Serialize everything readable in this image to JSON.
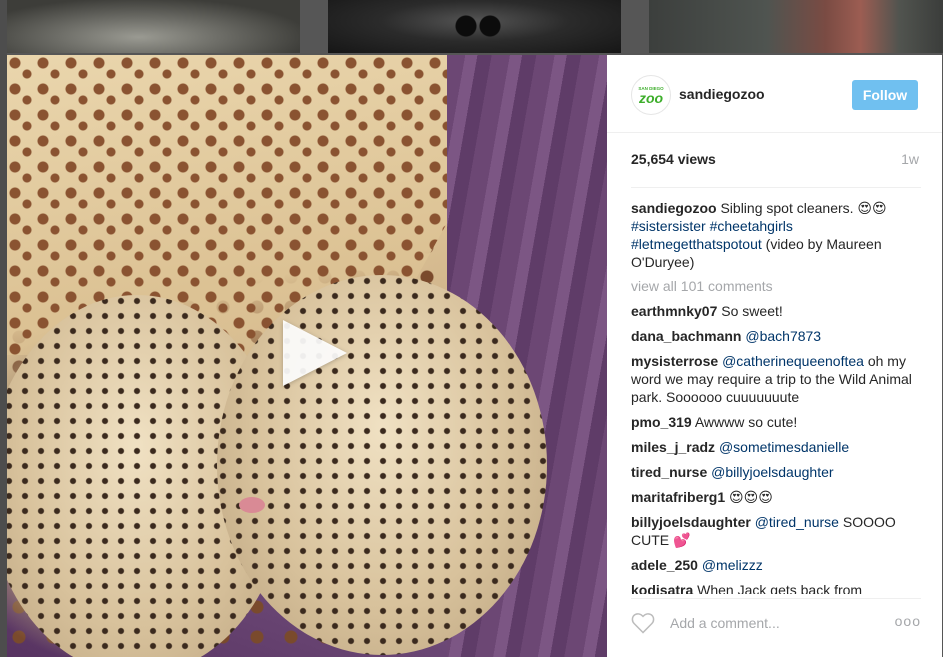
{
  "post": {
    "account": {
      "username": "sandiegozoo",
      "logo_text": "SAN DIEGO",
      "logo_word": "zoo",
      "follow_label": "Follow"
    },
    "views": "25,654 views",
    "age": "1w",
    "caption": {
      "user": "sandiegozoo",
      "text": "Sibling spot cleaners.",
      "emoji": "😍😍",
      "tags_line1": "#sistersister #cheetahgirls",
      "tag3": "#letmegetthatspotout",
      "credit": "(video by Maureen O'Duryee)"
    },
    "view_all": "view all 101 comments",
    "comments": [
      {
        "user": "earthmnky07",
        "mention": "",
        "text": "So sweet!"
      },
      {
        "user": "dana_bachmann",
        "mention": "@bach7873",
        "text": ""
      },
      {
        "user": "mysisterrose",
        "mention": "@catherinequeenoftea",
        "text": "oh my word we may require a trip to the Wild Animal park. Soooooo cuuuuuuute"
      },
      {
        "user": "pmo_319",
        "mention": "",
        "text": "Awwww so cute!"
      },
      {
        "user": "miles_j_radz",
        "mention": "@sometimesdanielle",
        "text": ""
      },
      {
        "user": "tired_nurse",
        "mention": "@billyjoelsdaughter",
        "text": ""
      },
      {
        "user": "maritafriberg1",
        "mention": "",
        "text": "😍😍😍"
      },
      {
        "user": "billyjoelsdaughter",
        "mention": "@tired_nurse",
        "text": "SOOOO CUTE 💕"
      },
      {
        "user": "adele_250",
        "mention": "@melizzz",
        "text": ""
      },
      {
        "user": "kodisatra",
        "mention": "",
        "text": "When Jack gets back from"
      }
    ],
    "add_comment_placeholder": "Add a comment...",
    "more_label": "ooo"
  },
  "icons": {
    "play": "play-icon",
    "heart": "heart-icon",
    "more": "more-options-icon"
  },
  "colors": {
    "follow_button": "#70c0f0",
    "link": "#003569",
    "muted": "#a5a7aa",
    "logo_green": "#3dae2b"
  }
}
